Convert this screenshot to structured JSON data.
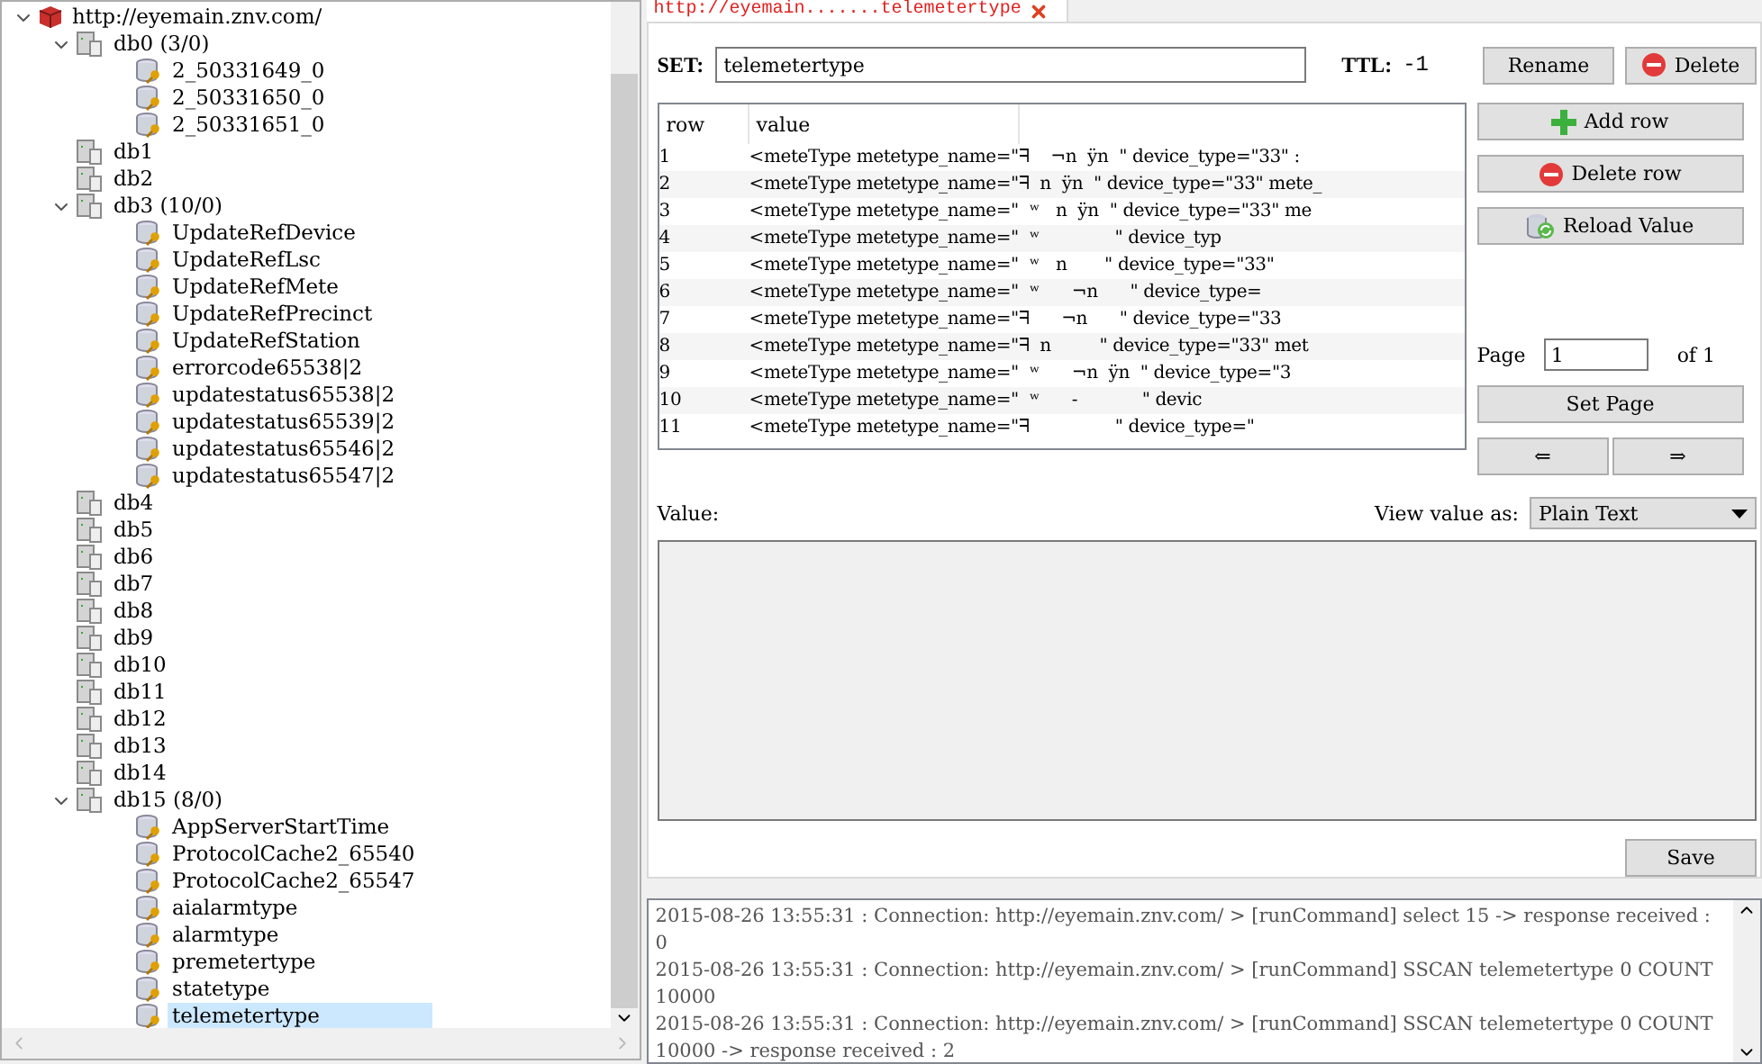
{
  "tree": {
    "label": "http://eyemain.znv.com/",
    "kind": "server",
    "expanded": true,
    "selected": false,
    "children": [
      {
        "label": "db0 (3/0)",
        "kind": "db",
        "expanded": true,
        "selected": false,
        "children": [
          {
            "label": "2_50331649_0",
            "kind": "key",
            "selected": false
          },
          {
            "label": "2_50331650_0",
            "kind": "key",
            "selected": false
          },
          {
            "label": "2_50331651_0",
            "kind": "key",
            "selected": false
          }
        ]
      },
      {
        "label": "db1",
        "kind": "db",
        "expanded": false,
        "selected": false
      },
      {
        "label": "db2",
        "kind": "db",
        "expanded": false,
        "selected": false
      },
      {
        "label": "db3 (10/0)",
        "kind": "db",
        "expanded": true,
        "selected": false,
        "children": [
          {
            "label": "UpdateRefDevice",
            "kind": "key",
            "selected": false
          },
          {
            "label": "UpdateRefLsc",
            "kind": "key",
            "selected": false
          },
          {
            "label": "UpdateRefMete",
            "kind": "key",
            "selected": false
          },
          {
            "label": "UpdateRefPrecinct",
            "kind": "key",
            "selected": false
          },
          {
            "label": "UpdateRefStation",
            "kind": "key",
            "selected": false
          },
          {
            "label": "errorcode65538|2",
            "kind": "key",
            "selected": false
          },
          {
            "label": "updatestatus65538|2",
            "kind": "key",
            "selected": false
          },
          {
            "label": "updatestatus65539|2",
            "kind": "key",
            "selected": false
          },
          {
            "label": "updatestatus65546|2",
            "kind": "key",
            "selected": false
          },
          {
            "label": "updatestatus65547|2",
            "kind": "key",
            "selected": false
          }
        ]
      },
      {
        "label": "db4",
        "kind": "db",
        "expanded": false,
        "selected": false
      },
      {
        "label": "db5",
        "kind": "db",
        "expanded": false,
        "selected": false
      },
      {
        "label": "db6",
        "kind": "db",
        "expanded": false,
        "selected": false
      },
      {
        "label": "db7",
        "kind": "db",
        "expanded": false,
        "selected": false
      },
      {
        "label": "db8",
        "kind": "db",
        "expanded": false,
        "selected": false
      },
      {
        "label": "db9",
        "kind": "db",
        "expanded": false,
        "selected": false
      },
      {
        "label": "db10",
        "kind": "db",
        "expanded": false,
        "selected": false
      },
      {
        "label": "db11",
        "kind": "db",
        "expanded": false,
        "selected": false
      },
      {
        "label": "db12",
        "kind": "db",
        "expanded": false,
        "selected": false
      },
      {
        "label": "db13",
        "kind": "db",
        "expanded": false,
        "selected": false
      },
      {
        "label": "db14",
        "kind": "db",
        "expanded": false,
        "selected": false
      },
      {
        "label": "db15 (8/0)",
        "kind": "db",
        "expanded": true,
        "selected": false,
        "children": [
          {
            "label": "AppServerStartTime",
            "kind": "key",
            "selected": false
          },
          {
            "label": "ProtocolCache2_65540",
            "kind": "key",
            "selected": false
          },
          {
            "label": "ProtocolCache2_65547",
            "kind": "key",
            "selected": false
          },
          {
            "label": "aialarmtype",
            "kind": "key",
            "selected": false
          },
          {
            "label": "alarmtype",
            "kind": "key",
            "selected": false
          },
          {
            "label": "premetertype",
            "kind": "key",
            "selected": false
          },
          {
            "label": "statetype",
            "kind": "key",
            "selected": false
          },
          {
            "label": "telemetertype",
            "kind": "key",
            "selected": true
          }
        ]
      }
    ]
  },
  "tab": {
    "label": "http://eyemain.......telemetertype"
  },
  "key_editor": {
    "type_label": "SET:",
    "key_name": "telemetertype",
    "ttl_label": "TTL:",
    "ttl": "-1",
    "buttons": [
      {
        "label": "Rename"
      },
      {
        "label": "Delete"
      }
    ]
  },
  "table": {
    "columns": [
      "row",
      "value"
    ],
    "rows": [
      {
        "row": "1",
        "value": "<meteType metetype_name=\"ᖷ    ¬n  ÿn  \" device_type=\"33\" :"
      },
      {
        "row": "2",
        "value": "<meteType metetype_name=\"ᖷ  n  ÿn  \" device_type=\"33\" mete_"
      },
      {
        "row": "3",
        "value": "<meteType metetype_name=\"  ʷ   n  ÿn  \" device_type=\"33\" me"
      },
      {
        "row": "4",
        "value": "<meteType metetype_name=\"  ʷ              \" device_typ"
      },
      {
        "row": "5",
        "value": "<meteType metetype_name=\"  ʷ   n       \" device_type=\"33\""
      },
      {
        "row": "6",
        "value": "<meteType metetype_name=\"  ʷ      ¬n      \" device_type="
      },
      {
        "row": "7",
        "value": "<meteType metetype_name=\"ᖷ      ¬n      \" device_type=\"33"
      },
      {
        "row": "8",
        "value": "<meteType metetype_name=\"ᖷ  n         \" device_type=\"33\" met"
      },
      {
        "row": "9",
        "value": "<meteType metetype_name=\"  ʷ      ¬n  ÿn  \" device_type=\"3"
      },
      {
        "row": "10",
        "value": "<meteType metetype_name=\"  ʷ      -            \" devic"
      },
      {
        "row": "11",
        "value": "<meteType metetype_name=\"ᖷ                \" device_type=\""
      }
    ]
  },
  "row_actions": [
    {
      "label": "Add row"
    },
    {
      "label": "Delete row"
    },
    {
      "label": "Reload Value"
    }
  ],
  "pager": {
    "label": "Page",
    "value": "1",
    "total": "of 1",
    "button": "Set Page",
    "nav": [
      "⇐",
      "⇒"
    ]
  },
  "value_panel": {
    "label": "Value:",
    "view_as_label": "View value as:",
    "view_as": "Plain Text",
    "save": "Save"
  },
  "log": [
    "2015-08-26 13:55:31 : Connection: http://eyemain.znv.com/ > [runCommand] select 15 -> response received : 0",
    "2015-08-26 13:55:31 : Connection: http://eyemain.znv.com/ > [runCommand] SSCAN telemetertype 0 COUNT 10000",
    "2015-08-26 13:55:31 : Connection: http://eyemain.znv.com/ > [runCommand] SSCAN telemetertype 0 COUNT 10000 -> response received : 2"
  ]
}
